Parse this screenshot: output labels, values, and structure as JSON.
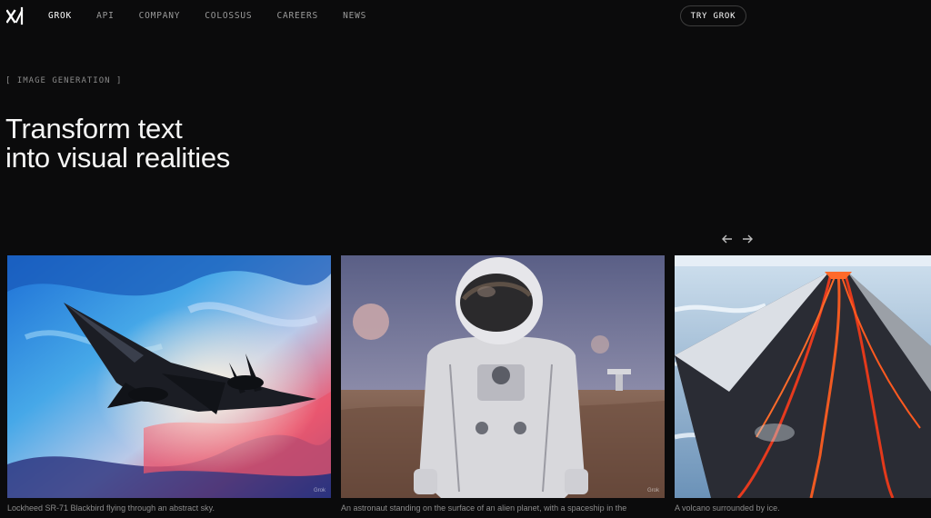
{
  "nav": {
    "logo_text": "xAI",
    "links": [
      {
        "label": "GROK",
        "active": true
      },
      {
        "label": "API",
        "active": false
      },
      {
        "label": "COMPANY",
        "active": false
      },
      {
        "label": "COLOSSUS",
        "active": false
      },
      {
        "label": "CAREERS",
        "active": false
      },
      {
        "label": "NEWS",
        "active": false
      }
    ],
    "cta_label": "TRY GROK"
  },
  "hero": {
    "eyebrow": "[ IMAGE GENERATION ]",
    "headline_line1": "Transform text",
    "headline_line2": "into visual realities"
  },
  "gallery": {
    "items": [
      {
        "caption": "Lockheed SR-71 Blackbird flying through an abstract sky.",
        "watermark": "Grok"
      },
      {
        "caption": "An astronaut standing on the surface of an alien planet, with a spaceship in the",
        "watermark": "Grok"
      },
      {
        "caption": "A volcano surrounded by ice.",
        "watermark": ""
      }
    ],
    "prev_icon": "arrow-left-icon",
    "next_icon": "arrow-right-icon"
  },
  "colors": {
    "background": "#0b0b0c",
    "text": "#f2f2f2",
    "muted": "#9a9a9a"
  }
}
